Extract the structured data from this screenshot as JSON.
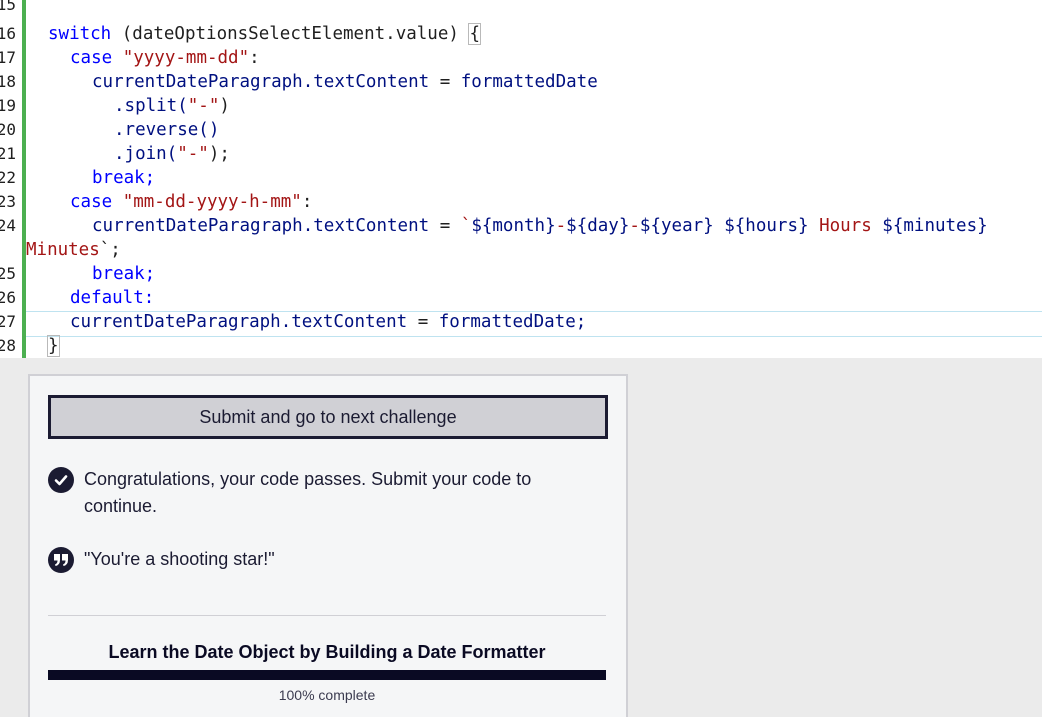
{
  "editor": {
    "line_numbers": [
      "15",
      "16",
      "17",
      "18",
      "19",
      "20",
      "21",
      "22",
      "23",
      "24",
      "25",
      "26",
      "27",
      "28"
    ],
    "code": {
      "l16_kw": "switch",
      "l16_rest": " (dateOptionsSelectElement.value) ",
      "l16_brace": "{",
      "l17_kw": "case",
      "l17_str": "\"yyyy-mm-dd\"",
      "l17_end": ":",
      "l18_prop": "currentDateParagraph.textContent",
      "l18_op": " = ",
      "l18_val": "formattedDate",
      "l19_a": ".split(",
      "l19_str": "\"-\"",
      "l19_b": ")",
      "l20": ".reverse()",
      "l21_a": ".join(",
      "l21_str": "\"-\"",
      "l21_b": ");",
      "l22": "break;",
      "l23_kw": "case",
      "l23_str": "\"mm-dd-yyyy-h-mm\"",
      "l23_end": ":",
      "l24_prop": "currentDateParagraph.textContent",
      "l24_op": " = ",
      "l24_tick": "`",
      "l24_t1": "${month}",
      "l24_d1": "-",
      "l24_t2": "${day}",
      "l24_d2": "-",
      "l24_t3": "${year}",
      "l24_sp": " ",
      "l24_t4": "${hours}",
      "l24_hours": " Hours ",
      "l24_t5": "${minutes}",
      "l24w_minutes": "Minutes",
      "l24w_end": "`;",
      "l25": "break;",
      "l26": "default:",
      "l27_prop": "currentDateParagraph.textContent",
      "l27_op": " = ",
      "l27_val": "formattedDate;",
      "l28": "}"
    }
  },
  "panel": {
    "submit_label": "Submit and go to next challenge",
    "success_message": "Congratulations, your code passes. Submit your code to continue.",
    "quote": "\"You're a shooting star!\"",
    "course_title": "Learn the Date Object by Building a Date Formatter",
    "progress_percent": 100,
    "progress_label": "100% complete"
  },
  "colors": {
    "gutter_bar": "#4caf50",
    "keyword": "#0000ff",
    "string": "#a31515",
    "property": "#001080",
    "dark": "#1b1b32"
  },
  "icons": {
    "success": "check-circle-icon",
    "quote": "quote-icon"
  }
}
